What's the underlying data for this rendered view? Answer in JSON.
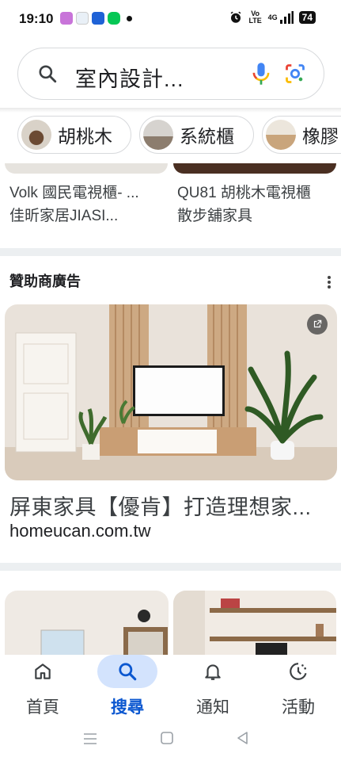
{
  "status_bar": {
    "time": "19:10",
    "battery": "74",
    "network": "4G",
    "volte": "Vo LTE"
  },
  "search": {
    "query": "室內設計..."
  },
  "chips": [
    {
      "label": "胡桃木"
    },
    {
      "label": "系統櫃"
    },
    {
      "label": "橡膠"
    }
  ],
  "results": [
    {
      "title_line1": "Volk 國民電視櫃- ...",
      "title_line2": "佳昕家居JIASI..."
    },
    {
      "title_line1": "QU81 胡桃木電視櫃",
      "title_line2": "散步舖家具"
    }
  ],
  "sponsored": {
    "label": "贊助商廣告",
    "ad_title": "屏東家具【優肯】打造理想家...",
    "ad_url": "homeucan.com.tw"
  },
  "bottom_nav": [
    {
      "label": "首頁",
      "icon": "home-icon",
      "active": false
    },
    {
      "label": "搜尋",
      "icon": "search-icon",
      "active": true
    },
    {
      "label": "通知",
      "icon": "bell-icon",
      "active": false
    },
    {
      "label": "活動",
      "icon": "activity-icon",
      "active": false
    }
  ],
  "colors": {
    "accent": "#0b57d0",
    "active_pill": "#d3e3fd"
  }
}
